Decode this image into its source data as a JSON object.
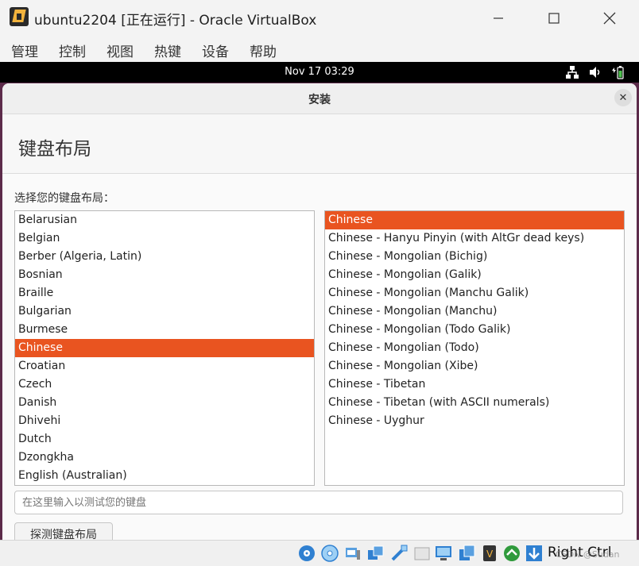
{
  "window": {
    "title": "ubuntu2204 [正在运行] - Oracle VirtualBox",
    "menu": [
      "管理",
      "控制",
      "视图",
      "热键",
      "设备",
      "帮助"
    ]
  },
  "guest_topbar": {
    "clock": "Nov 17  03:29",
    "tray_icons": [
      "network-icon",
      "volume-icon",
      "battery-icon"
    ]
  },
  "dialog": {
    "title": "安装",
    "close_label": "✕",
    "page_title": "键盘布局",
    "prompt": "选择您的键盘布局：",
    "layouts": [
      "Belarusian",
      "Belgian",
      "Berber (Algeria, Latin)",
      "Bosnian",
      "Braille",
      "Bulgarian",
      "Burmese",
      "Chinese",
      "Croatian",
      "Czech",
      "Danish",
      "Dhivehi",
      "Dutch",
      "Dzongkha",
      "English (Australian)"
    ],
    "selected_layout": "Chinese",
    "variants": [
      "Chinese",
      "Chinese - Hanyu Pinyin (with AltGr dead keys)",
      "Chinese - Mongolian (Bichig)",
      "Chinese - Mongolian (Galik)",
      "Chinese - Mongolian (Manchu Galik)",
      "Chinese - Mongolian (Manchu)",
      "Chinese - Mongolian (Todo Galik)",
      "Chinese - Mongolian (Todo)",
      "Chinese - Mongolian (Xibe)",
      "Chinese - Tibetan",
      "Chinese - Tibetan (with ASCII numerals)",
      "Chinese - Uyghur"
    ],
    "selected_variant": "Chinese",
    "test_placeholder": "在这里输入以测试您的键盘",
    "detect_button": "探测键盘布局"
  },
  "statusbar": {
    "host_key": "Right Ctrl",
    "watermark": "CSDN @Sudan"
  },
  "colors": {
    "accent": "#e95420",
    "guest_bg": "#5c2b4a"
  }
}
